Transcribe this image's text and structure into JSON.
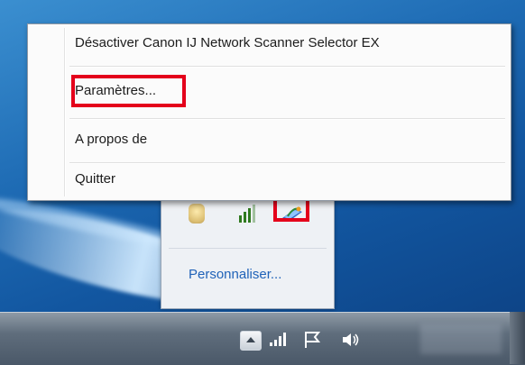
{
  "context_menu": {
    "items": [
      {
        "label": "Désactiver Canon IJ Network Scanner Selector EX"
      },
      {
        "label": "Paramètres..."
      },
      {
        "label": "A propos de"
      },
      {
        "label": "Quitter"
      }
    ]
  },
  "notification_panel": {
    "icons": [
      "app-icon",
      "signal-icon",
      "scanner-selector-icon"
    ],
    "customize_link": "Personnaliser..."
  },
  "taskbar": {
    "tray_icons": [
      "show-hidden-icons-arrow",
      "network-icon",
      "flag-icon",
      "speaker-icon"
    ]
  },
  "colors": {
    "highlight": "#e4001b",
    "link": "#1f62b8"
  }
}
